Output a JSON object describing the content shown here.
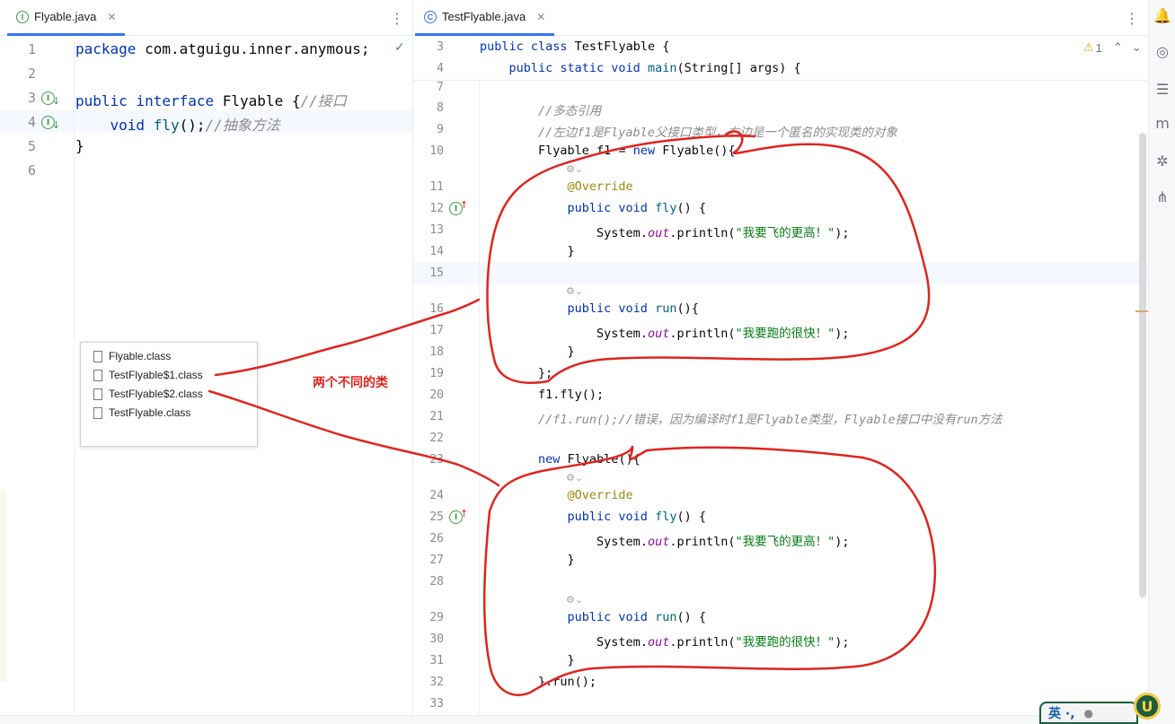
{
  "left_editor": {
    "tab": {
      "icon": "interface-icon",
      "icon_glyph": "I",
      "title": "Flyable.java",
      "close": "✕"
    },
    "more": "⋮",
    "check": "✓",
    "lines": [
      {
        "n": "1",
        "segs": [
          {
            "t": "package ",
            "c": "kw"
          },
          {
            "t": "com.atguigu.inner.anymous;",
            "c": ""
          }
        ]
      },
      {
        "n": "2",
        "segs": []
      },
      {
        "n": "3",
        "segs": [
          {
            "t": "public interface ",
            "c": "kw"
          },
          {
            "t": "Flyable {",
            "c": ""
          },
          {
            "t": "//接口",
            "c": "cmt"
          }
        ]
      },
      {
        "n": "4",
        "segs": [
          {
            "t": "    void ",
            "c": "kw"
          },
          {
            "t": "fly",
            "c": "fn"
          },
          {
            "t": "();",
            "c": ""
          },
          {
            "t": "//抽象方法",
            "c": "cmt"
          }
        ]
      },
      {
        "n": "5",
        "segs": [
          {
            "t": "}",
            "c": ""
          }
        ]
      },
      {
        "n": "6",
        "segs": []
      }
    ]
  },
  "right_editor": {
    "tab": {
      "icon": "class-icon",
      "icon_glyph": "C",
      "title": "TestFlyable.java",
      "close": "✕"
    },
    "more": "⋮",
    "inspection": {
      "warning_icon": "⚠",
      "count": "1",
      "up": "⌃",
      "down": "⌄"
    },
    "sticky": [
      {
        "n": "3",
        "segs": [
          {
            "t": "public class ",
            "c": "kw"
          },
          {
            "t": "TestFlyable {",
            "c": ""
          }
        ]
      },
      {
        "n": "4",
        "segs": [
          {
            "t": "    public static void ",
            "c": "kw"
          },
          {
            "t": "main",
            "c": "fn"
          },
          {
            "t": "(String[] args) {",
            "c": ""
          }
        ]
      }
    ],
    "lines": [
      {
        "n": "7",
        "segs": []
      },
      {
        "n": "8",
        "segs": [
          {
            "t": "        //多态引用",
            "c": "cmt"
          }
        ]
      },
      {
        "n": "9",
        "segs": [
          {
            "t": "        //左边f1是Flyable父接口类型，右边是一个匿名的实现类的对象",
            "c": "cmt"
          }
        ]
      },
      {
        "n": "10",
        "segs": [
          {
            "t": "        Flyable f1 = ",
            "c": ""
          },
          {
            "t": "new ",
            "c": "kw"
          },
          {
            "t": "Flyable(){",
            "c": ""
          }
        ]
      },
      {
        "n": "11",
        "segs": [
          {
            "t": "            @Override",
            "c": "ann"
          }
        ]
      },
      {
        "n": "12",
        "segs": [
          {
            "t": "            public void ",
            "c": "kw"
          },
          {
            "t": "fly",
            "c": "fn"
          },
          {
            "t": "() {",
            "c": ""
          }
        ]
      },
      {
        "n": "13",
        "segs": [
          {
            "t": "                System.",
            "c": ""
          },
          {
            "t": "out",
            "c": "static"
          },
          {
            "t": ".println(",
            "c": ""
          },
          {
            "t": "\"我要飞的更高！\"",
            "c": "str"
          },
          {
            "t": ");",
            "c": ""
          }
        ]
      },
      {
        "n": "14",
        "segs": [
          {
            "t": "            }",
            "c": ""
          }
        ]
      },
      {
        "n": "15",
        "segs": []
      },
      {
        "n": "16",
        "segs": [
          {
            "t": "            public void ",
            "c": "kw"
          },
          {
            "t": "run",
            "c": "fn"
          },
          {
            "t": "(){",
            "c": ""
          }
        ]
      },
      {
        "n": "17",
        "segs": [
          {
            "t": "                System.",
            "c": ""
          },
          {
            "t": "out",
            "c": "static"
          },
          {
            "t": ".println(",
            "c": ""
          },
          {
            "t": "\"我要跑的很快！\"",
            "c": "str"
          },
          {
            "t": ");",
            "c": ""
          }
        ]
      },
      {
        "n": "18",
        "segs": [
          {
            "t": "            }",
            "c": ""
          }
        ]
      },
      {
        "n": "19",
        "segs": [
          {
            "t": "        };",
            "c": ""
          }
        ]
      },
      {
        "n": "20",
        "segs": [
          {
            "t": "        f1.fly();",
            "c": ""
          }
        ]
      },
      {
        "n": "21",
        "segs": [
          {
            "t": "        //f1.run();//错误，因为编译时f1是Flyable类型，Flyable接口中没有run方法",
            "c": "cmt"
          }
        ]
      },
      {
        "n": "22",
        "segs": []
      },
      {
        "n": "23",
        "segs": [
          {
            "t": "        ",
            "c": ""
          },
          {
            "t": "new ",
            "c": "kw"
          },
          {
            "t": "Flyable(){",
            "c": ""
          }
        ]
      },
      {
        "n": "24",
        "segs": [
          {
            "t": "            @Override",
            "c": "ann"
          }
        ]
      },
      {
        "n": "25",
        "segs": [
          {
            "t": "            public void ",
            "c": "kw"
          },
          {
            "t": "fly",
            "c": "fn"
          },
          {
            "t": "() {",
            "c": ""
          }
        ]
      },
      {
        "n": "26",
        "segs": [
          {
            "t": "                System.",
            "c": ""
          },
          {
            "t": "out",
            "c": "static"
          },
          {
            "t": ".println(",
            "c": ""
          },
          {
            "t": "\"我要飞的更高！\"",
            "c": "str"
          },
          {
            "t": ");",
            "c": ""
          }
        ]
      },
      {
        "n": "27",
        "segs": [
          {
            "t": "            }",
            "c": ""
          }
        ]
      },
      {
        "n": "28",
        "segs": []
      },
      {
        "n": "29",
        "segs": [
          {
            "t": "            public void ",
            "c": "kw"
          },
          {
            "t": "run",
            "c": "fn"
          },
          {
            "t": "() {",
            "c": ""
          }
        ]
      },
      {
        "n": "30",
        "segs": [
          {
            "t": "                System.",
            "c": ""
          },
          {
            "t": "out",
            "c": "static"
          },
          {
            "t": ".println(",
            "c": ""
          },
          {
            "t": "\"我要跑的很快！\"",
            "c": "str"
          },
          {
            "t": ");",
            "c": ""
          }
        ]
      },
      {
        "n": "31",
        "segs": [
          {
            "t": "            }",
            "c": ""
          }
        ]
      },
      {
        "n": "32",
        "segs": [
          {
            "t": "        }.run();",
            "c": ""
          }
        ]
      },
      {
        "n": "33",
        "segs": []
      }
    ],
    "inlay_hint": "⚙⌄"
  },
  "class_files": [
    "Flyable.class",
    "TestFlyable$1.class",
    "TestFlyable$2.class",
    "TestFlyable.class"
  ],
  "annotation": {
    "label": "两个不同的类",
    "color": "#e0241f"
  },
  "right_toolbar": [
    {
      "name": "notifications-icon",
      "glyph": "🔔"
    },
    {
      "name": "ai-assistant-icon",
      "glyph": "◎"
    },
    {
      "name": "database-icon",
      "glyph": "☰"
    },
    {
      "name": "maven-icon",
      "glyph": "m"
    },
    {
      "name": "plugin-icon",
      "glyph": "✲"
    },
    {
      "name": "structure-icon",
      "glyph": "⋔"
    }
  ],
  "ime": {
    "label": "英 ·,",
    "logo": "U"
  }
}
